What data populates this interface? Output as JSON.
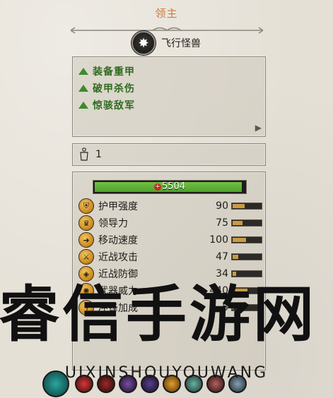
{
  "header": {
    "title": "领主"
  },
  "unit_type": {
    "label": "飞行怪兽",
    "icon": "flying-monster-emblem-icon"
  },
  "abilities": [
    {
      "label": "装备重甲",
      "icon": "green-up-triangle-icon"
    },
    {
      "label": "破甲杀伤",
      "icon": "green-up-triangle-icon"
    },
    {
      "label": "惊骇敌军",
      "icon": "green-up-triangle-icon"
    }
  ],
  "rank": {
    "value": "1",
    "icon": "rank-chevron-icon"
  },
  "health": {
    "value": "5504",
    "fraction": 0.98,
    "color": "#4ba22b"
  },
  "stats": [
    {
      "name": "护甲强度",
      "value": "90",
      "fraction": 0.45,
      "icon": "armor-icon"
    },
    {
      "name": "领导力",
      "value": "75",
      "fraction": 0.38,
      "icon": "leadership-icon"
    },
    {
      "name": "移动速度",
      "value": "100",
      "fraction": 0.5,
      "icon": "speed-icon"
    },
    {
      "name": "近战攻击",
      "value": "47",
      "fraction": 0.24,
      "icon": "melee-attack-icon"
    },
    {
      "name": "近战防御",
      "value": "34",
      "fraction": 0.17,
      "icon": "melee-defense-icon"
    },
    {
      "name": "武器威力",
      "value": "440",
      "fraction": 0.55,
      "icon": "weapon-strength-icon"
    },
    {
      "name": "冲锋加成",
      "value": "5",
      "fraction": 0.05,
      "icon": "charge-bonus-icon"
    }
  ],
  "watermark": {
    "big": "睿信手游网",
    "small": "UIXINSHOUYOUWANG"
  },
  "colors": {
    "title": "#d0783a",
    "ability_text": "#2f6b1e",
    "bar_fill": "#c99a42"
  }
}
